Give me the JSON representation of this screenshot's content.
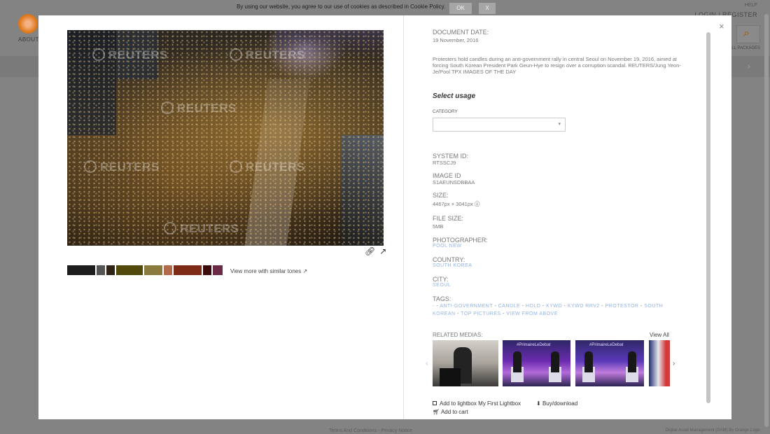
{
  "background_page": {
    "about": "ABOUT",
    "help": "HELP",
    "login_register": "LOGIN / REGISTER",
    "all_packages": "ALL PACKAGES",
    "footer_terms": "Terms And Conditions - Privacy Notice",
    "footer_right": "Digital Asset Management (DAM) By Orange Logic"
  },
  "cookie": {
    "text": "By using our website, you agree to our use of cookies as described in Cookie Policy.",
    "ok": "OK",
    "close": "X"
  },
  "modal": {
    "close": "×",
    "photo_watermark": "REUTERS",
    "similar_tones": "View more with similar tones",
    "swatch_colors": [
      "#1d1d1d",
      "#545454",
      "#2e2314",
      "#51480a",
      "#8a7a3d",
      "#b1694a",
      "#7d2a16",
      "#3b0b0b",
      "#6b2a45"
    ],
    "details": {
      "document_date_label": "DOCUMENT DATE:",
      "document_date": "19 November, 2016",
      "caption": "Protesters hold candles during an anti-government rally in central Seoul on November 19, 2016, aimed at forcing South Korean President Park Geun-Hye to resign over a corruption scandal. REUTERS/Jung Yeon-Je/Pool TPX IMAGES OF THE DAY",
      "select_usage": "Select usage",
      "category_label": "CATEGORY",
      "category_value": "",
      "system_id_label": "SYSTEM ID:",
      "system_id": "RTSSCJ9",
      "image_id_label": "IMAGE ID",
      "image_id": "S1AEUNSDBBAA",
      "size_label": "SIZE:",
      "size": "4467px × 3041px",
      "file_size_label": "FILE SIZE:",
      "file_size": "5MB",
      "photographer_label": "PHOTOGRAPHER:",
      "photographer": "POOL NEW",
      "country_label": "COUNTRY:",
      "country": "SOUTH KOREA",
      "city_label": "CITY:",
      "city": "SEOUL",
      "tags_label": "TAGS:",
      "tags": [
        "-",
        "ANTI-GOVERNMENT",
        "CANDLE",
        "HOLD",
        "KYWD",
        "KYWD RRV2",
        "PROTESTOR",
        "SOUTH KOREAN",
        "TOP PICTURES",
        "VIEW FROM ABOVE"
      ]
    },
    "related": {
      "label": "RELATED MEDIAS:",
      "view_all": "View All",
      "debate_banner": "#PrimaireLeDebat"
    },
    "actions": {
      "lightbox": "Add to lightbox My First Lightbox",
      "buy": "Buy/download",
      "cart": "Add to cart"
    }
  }
}
